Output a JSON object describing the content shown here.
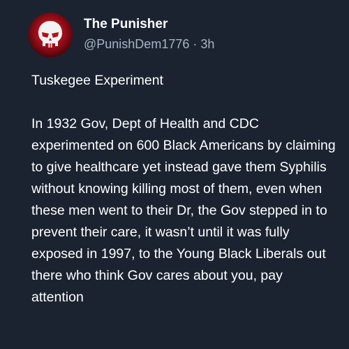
{
  "post": {
    "author": {
      "display_name": "The Punisher",
      "handle": "@PunishDem1776",
      "separator": "·",
      "timestamp": "3h",
      "avatar_icon": "punisher-skull-icon"
    },
    "title": "Tuskegee Experiment",
    "body": "In 1932 Gov, Dept of Health and CDC experimented on 600 Black Americans by claiming to give healthcare yet instead gave them Syphilis without knowing killing most of them, even when these men went to their Dr, the Gov stepped in to prevent their care, it wasn’t until it was fully exposed in 1997, to the Young Black Liberals out there who think Gov cares about you, pay attention"
  },
  "colors": {
    "background": "#1b2330",
    "text_primary": "#ffffff",
    "text_secondary": "#a8b4c4",
    "avatar_accent": "#d11a2a"
  }
}
